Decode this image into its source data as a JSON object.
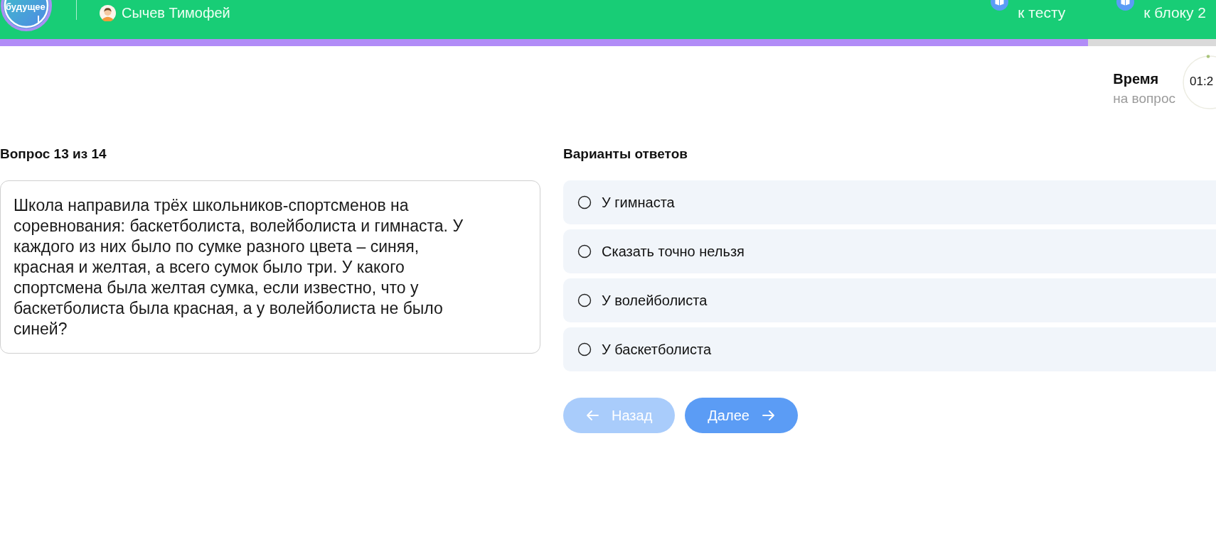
{
  "header": {
    "logo_text": "будущее",
    "user": {
      "name": "Сычев Тимофей"
    },
    "links": [
      {
        "label": "к тесту"
      },
      {
        "label": "к блоку 2"
      }
    ]
  },
  "progress": {
    "level": 0.895
  },
  "timer": {
    "title": "Время",
    "subtitle": "на вопрос",
    "value": "01:2"
  },
  "question": {
    "counter": "Вопрос 13 из 14",
    "text": "Школа направила трёх школьников-спортсменов на соревнования: баскетболиста, волейболиста и гимнаста. У каждого из них было по сумке разного цвета – синяя, красная и желтая, а всего сумок было три. У какого спортсмена была желтая сумка, если известно, что у баскетболиста была красная, а у волейболиста не было синей?"
  },
  "answers": {
    "title": "Варианты ответов",
    "options": [
      {
        "label": "У гимнаста",
        "selected": false
      },
      {
        "label": "Сказать точно нельзя",
        "selected": false
      },
      {
        "label": "У волейболиста",
        "selected": false
      },
      {
        "label": "У баскетболиста",
        "selected": false
      }
    ]
  },
  "buttons": [
    {
      "kind": "back",
      "label": "Назад",
      "disabled": true
    },
    {
      "kind": "next",
      "label": "Далее",
      "disabled": false
    }
  ]
}
